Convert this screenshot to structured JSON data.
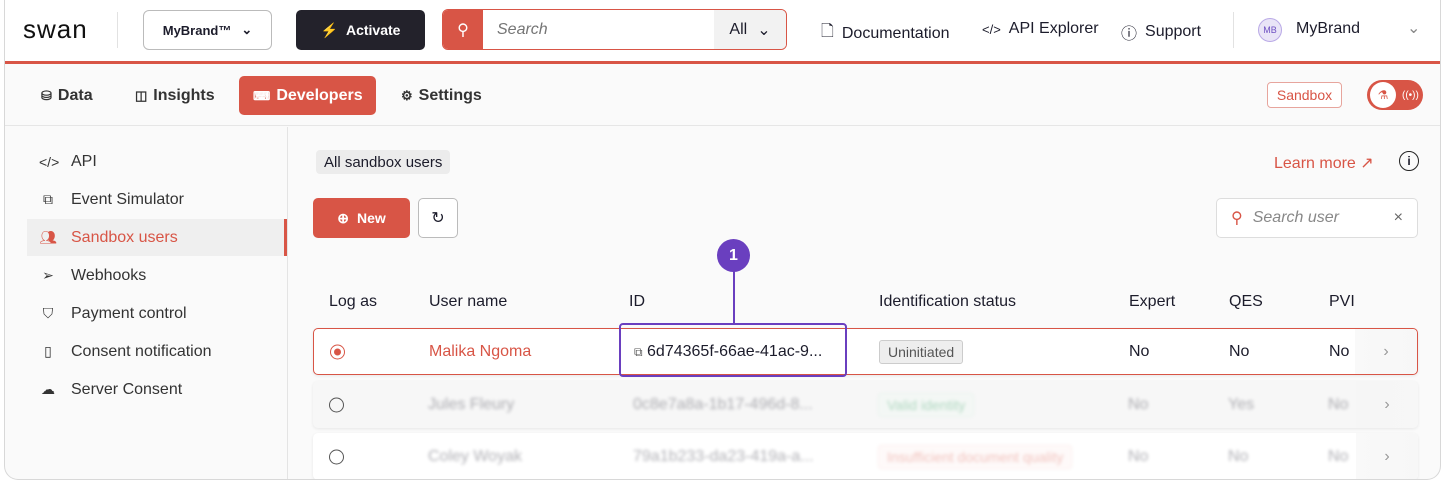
{
  "header": {
    "logo": "swan",
    "brand_selector": "MyBrand™",
    "activate_label": "Activate",
    "search_placeholder": "Search",
    "search_scope": "All",
    "links": [
      "Documentation",
      "API Explorer",
      "Support"
    ],
    "avatar_initials": "MB",
    "account_name": "MyBrand"
  },
  "nav": {
    "tabs": [
      "Data",
      "Insights",
      "Developers",
      "Settings"
    ],
    "active_tab": "Developers",
    "env_badge": "Sandbox"
  },
  "sidebar": {
    "items": [
      {
        "label": "API",
        "icon": "code-icon"
      },
      {
        "label": "Event Simulator",
        "icon": "simulator-icon"
      },
      {
        "label": "Sandbox users",
        "icon": "users-icon"
      },
      {
        "label": "Webhooks",
        "icon": "send-icon"
      },
      {
        "label": "Payment control",
        "icon": "shield-icon"
      },
      {
        "label": "Consent notification",
        "icon": "phone-icon"
      },
      {
        "label": "Server Consent",
        "icon": "cloud-icon"
      }
    ],
    "active": "Sandbox users"
  },
  "main": {
    "filter_chip": "All sandbox users",
    "learn_more": "Learn more",
    "new_label": "New",
    "search_user_placeholder": "Search user",
    "columns": [
      "Log as",
      "User name",
      "ID",
      "Identification status",
      "Expert",
      "QES",
      "PVI"
    ],
    "rows": [
      {
        "selected": true,
        "name": "Malika Ngoma",
        "id": "6d74365f-66ae-41ac-9...",
        "status": "Uninitiated",
        "expert": "No",
        "qes": "No",
        "pvi": "No"
      },
      {
        "selected": false,
        "name": "Jules Fleury",
        "id": "0c8e7a8a-1b17-496d-8...",
        "status": "Valid identity",
        "expert": "No",
        "qes": "Yes",
        "pvi": "No"
      },
      {
        "selected": false,
        "name": "Coley Woyak",
        "id": "79a1b233-da23-419a-a...",
        "status": "Insufficient document quality",
        "expert": "No",
        "qes": "No",
        "pvi": "No"
      }
    ]
  },
  "annotation": {
    "number": "1"
  },
  "colors": {
    "accent": "#d85546",
    "callout": "#6a3fbf",
    "dark": "#23222b"
  }
}
